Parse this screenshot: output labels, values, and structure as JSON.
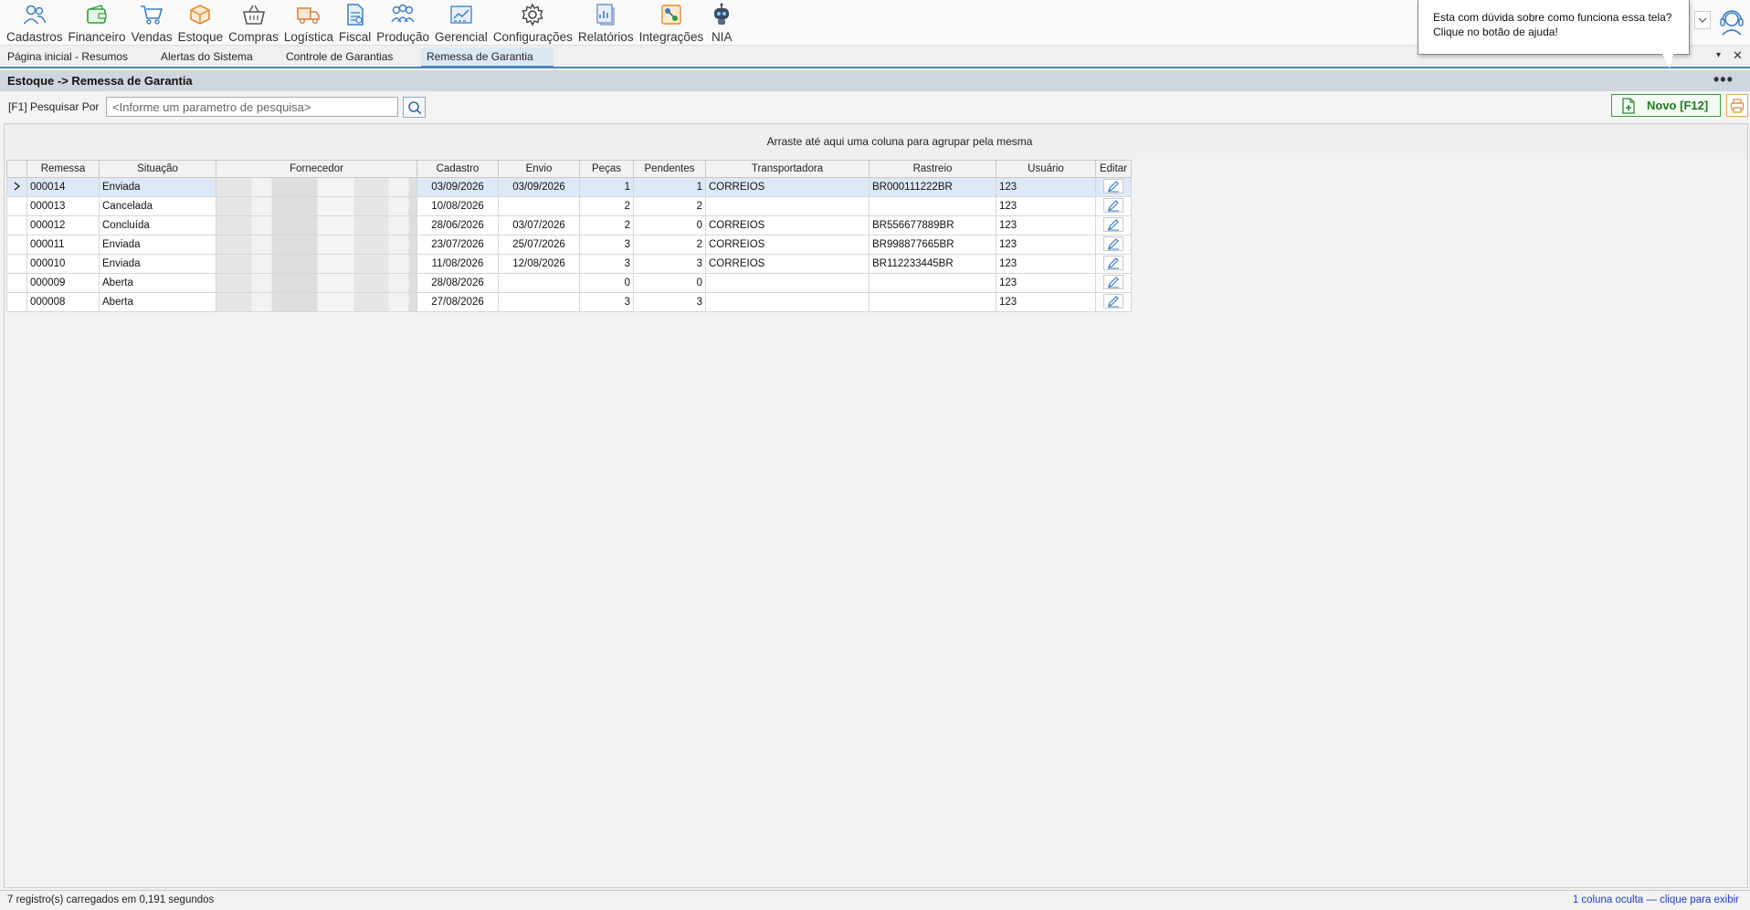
{
  "menu": [
    {
      "label": "Cadastros",
      "icon": "users-icon"
    },
    {
      "label": "Financeiro",
      "icon": "wallet-icon"
    },
    {
      "label": "Vendas",
      "icon": "cart-icon"
    },
    {
      "label": "Estoque",
      "icon": "box-icon"
    },
    {
      "label": "Compras",
      "icon": "basket-icon"
    },
    {
      "label": "Logística",
      "icon": "truck-icon"
    },
    {
      "label": "Fiscal",
      "icon": "document-icon"
    },
    {
      "label": "Produção",
      "icon": "factory-icon"
    },
    {
      "label": "Gerencial",
      "icon": "chart-icon"
    },
    {
      "label": "Configurações",
      "icon": "gear-icon"
    },
    {
      "label": "Relatórios",
      "icon": "report-icon"
    },
    {
      "label": "Integrações",
      "icon": "integration-icon"
    },
    {
      "label": "NIA",
      "icon": "robot-icon"
    }
  ],
  "help_balloon": {
    "line1": "Esta com dúvida sobre como funciona essa tela?",
    "line2": "Clique no botão de ajuda!"
  },
  "tabs": [
    {
      "label": "Página inicial - Resumos",
      "active": false
    },
    {
      "label": "Alertas do Sistema",
      "active": false
    },
    {
      "label": "Controle de Garantias",
      "active": false
    },
    {
      "label": "Remessa de Garantia",
      "active": true
    }
  ],
  "tab_controls": {
    "menu": "▾",
    "close": "✕"
  },
  "breadcrumb": {
    "title": "Estoque -> Remessa de Garantia",
    "more": "•••"
  },
  "search": {
    "label": "[F1] Pesquisar Por",
    "placeholder": "<Informe um parametro de pesquisa>"
  },
  "actions": {
    "new_label": "Novo [F12]"
  },
  "group_panel": "Arraste até aqui uma coluna para agrupar pela mesma",
  "grid": {
    "columns": [
      "Remessa",
      "Situação",
      "Fornecedor",
      "Cadastro",
      "Envio",
      "Peças",
      "Pendentes",
      "Transportadora",
      "Rastreio",
      "Usuário",
      "Editar"
    ],
    "rows": [
      {
        "remessa": "000014",
        "situacao": "Enviada",
        "cadastro": "03/09/2026",
        "envio": "03/09/2026",
        "pecas": "1",
        "pendentes": "1",
        "transportadora": "CORREIOS",
        "rastreio": "BR000111222BR",
        "usuario": "123",
        "selected": true
      },
      {
        "remessa": "000013",
        "situacao": "Cancelada",
        "cadastro": "10/08/2026",
        "envio": "",
        "pecas": "2",
        "pendentes": "2",
        "transportadora": "",
        "rastreio": "",
        "usuario": "123",
        "selected": false
      },
      {
        "remessa": "000012",
        "situacao": "Concluída",
        "cadastro": "28/06/2026",
        "envio": "03/07/2026",
        "pecas": "2",
        "pendentes": "0",
        "transportadora": "CORREIOS",
        "rastreio": "BR556677889BR",
        "usuario": "123",
        "selected": false
      },
      {
        "remessa": "000011",
        "situacao": "Enviada",
        "cadastro": "23/07/2026",
        "envio": "25/07/2026",
        "pecas": "3",
        "pendentes": "2",
        "transportadora": "CORREIOS",
        "rastreio": "BR998877665BR",
        "usuario": "123",
        "selected": false
      },
      {
        "remessa": "000010",
        "situacao": "Enviada",
        "cadastro": "11/08/2026",
        "envio": "12/08/2026",
        "pecas": "3",
        "pendentes": "3",
        "transportadora": "CORREIOS",
        "rastreio": "BR112233445BR",
        "usuario": "123",
        "selected": false
      },
      {
        "remessa": "000009",
        "situacao": "Aberta",
        "cadastro": "28/08/2026",
        "envio": "",
        "pecas": "0",
        "pendentes": "0",
        "transportadora": "",
        "rastreio": "",
        "usuario": "123",
        "selected": false
      },
      {
        "remessa": "000008",
        "situacao": "Aberta",
        "cadastro": "27/08/2026",
        "envio": "",
        "pecas": "3",
        "pendentes": "3",
        "transportadora": "",
        "rastreio": "",
        "usuario": "123",
        "selected": false
      }
    ]
  },
  "status": {
    "left": "7 registro(s) carregados em 0,191 segundos",
    "right": "1 coluna oculta — clique para exibir"
  },
  "colors": {
    "accent": "#4a84c4",
    "new_button": "#1f7a1f",
    "link": "#1f3fd0"
  }
}
